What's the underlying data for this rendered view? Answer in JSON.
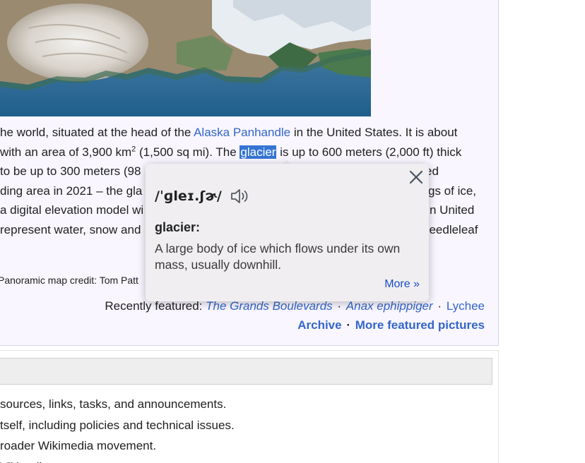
{
  "article": {
    "line1": {
      "before": "he world, situated at the head of the ",
      "link": "Alaska Panhandle",
      "after": " in the United States. It is about"
    },
    "line2": {
      "before": " with an area of 3,900 km",
      "sup": "2",
      "middle": " (1,500 sq mi). The ",
      "selected": "glacier",
      "after": " is up to 600 meters (2,000 ft) thick"
    },
    "line3": {
      "left": "to be up to 300 meters (98",
      "right": "ed"
    },
    "line4": {
      "left": "ding area in 2021 – the gla",
      "right": "gs of ice,"
    },
    "line5": {
      "left": "a digital elevation model wi",
      "right": "n United"
    },
    "line6": {
      "left": " represent water, snow and",
      "right": "needleleaf"
    },
    "credit": "Panoramic map credit: Tom Patt"
  },
  "recently_featured": {
    "label": "Recently featured:",
    "items": [
      "The Grands Boulevards",
      "Anax ephippiger",
      "Lychee"
    ],
    "separator": "·"
  },
  "footer_links": {
    "archive": "Archive",
    "more": "More featured pictures"
  },
  "lower_panel": {
    "lines": [
      "sources, links, tasks, and announcements.",
      "tself, including policies and technical issues.",
      "roader Wikimedia movement.",
      "Vikipedia."
    ]
  },
  "popup": {
    "phonetic": "/ˈɡleɪ.ʃɚ/",
    "headword": "glacier:",
    "definition": "A large body of ice which flows under its own mass, usually downhill.",
    "more": "More »",
    "icons": {
      "close": "close-icon",
      "audio": "speaker-icon"
    }
  },
  "colors": {
    "link": "#3366cc",
    "selection": "#3574d3",
    "panel_bg": "#f9f6ff",
    "popup_bg": "#f0eef1"
  }
}
